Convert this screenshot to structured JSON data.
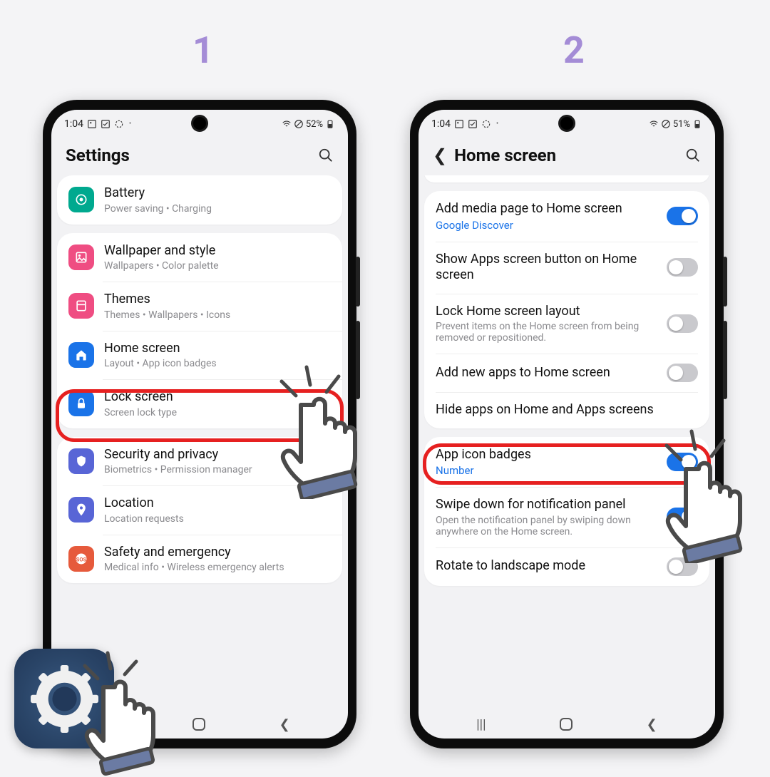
{
  "steps": {
    "one": "1",
    "two": "2"
  },
  "status": {
    "time": "1:04",
    "battery1": "52%",
    "battery2": "51%"
  },
  "phone1": {
    "title": "Settings",
    "groups": [
      [
        {
          "title": "Battery",
          "sub": "Power saving  •  Charging",
          "iconColor": "#00a98f",
          "icon": "battery"
        }
      ],
      [
        {
          "title": "Wallpaper and style",
          "sub": "Wallpapers  •  Color palette",
          "iconColor": "#ef4d82",
          "icon": "picture"
        },
        {
          "title": "Themes",
          "sub": "Themes  •  Wallpapers  •  Icons",
          "iconColor": "#ef4d82",
          "icon": "themes"
        },
        {
          "title": "Home screen",
          "sub": "Layout  •  App icon badges",
          "iconColor": "#1a73e8",
          "icon": "home"
        },
        {
          "title": "Lock screen",
          "sub": "Screen lock type",
          "iconColor": "#1a73e8",
          "icon": "lock"
        }
      ],
      [
        {
          "title": "Security and privacy",
          "sub": "Biometrics  •  Permission manager",
          "iconColor": "#5865d6",
          "icon": "shield"
        },
        {
          "title": "Location",
          "sub": "Location requests",
          "iconColor": "#5865d6",
          "icon": "pin"
        },
        {
          "title": "Safety and emergency",
          "sub": "Medical info  •  Wireless emergency alerts",
          "iconColor": "#e65a3c",
          "icon": "sos"
        }
      ]
    ]
  },
  "phone2": {
    "title": "Home screen",
    "groupA": [
      {
        "title": "Add media page to Home screen",
        "link": "Google Discover",
        "toggle": "on"
      },
      {
        "title": "Show Apps screen button on Home screen",
        "toggle": "off"
      },
      {
        "title": "Lock Home screen layout",
        "sub": "Prevent items on the Home screen from being removed or repositioned.",
        "toggle": "off"
      },
      {
        "title": "Add new apps to Home screen",
        "toggle": "off"
      },
      {
        "title": "Hide apps on Home and Apps screens"
      }
    ],
    "groupB": [
      {
        "title": "App icon badges",
        "link": "Number",
        "toggle": "on"
      },
      {
        "title": "Swipe down for notification panel",
        "sub": "Open the notification panel by swiping down anywhere on the Home screen.",
        "toggle": "on"
      },
      {
        "title": "Rotate to landscape mode",
        "toggle": "off"
      }
    ]
  }
}
